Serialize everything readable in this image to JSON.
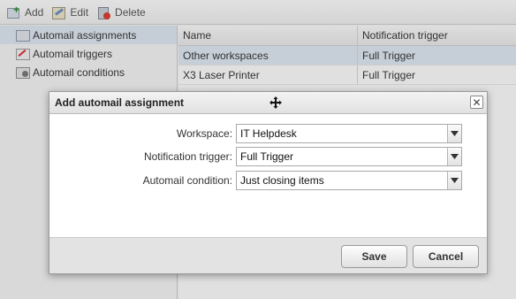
{
  "toolbar": {
    "add_label": "Add",
    "edit_label": "Edit",
    "delete_label": "Delete"
  },
  "sidebar": {
    "items": [
      {
        "label": "Automail assignments",
        "icon": "assignments-icon",
        "active": true
      },
      {
        "label": "Automail triggers",
        "icon": "triggers-icon",
        "active": false
      },
      {
        "label": "Automail conditions",
        "icon": "conditions-icon",
        "active": false
      }
    ]
  },
  "grid": {
    "columns": [
      "Name",
      "Notification trigger"
    ],
    "rows": [
      [
        "Other workspaces",
        "Full Trigger"
      ],
      [
        "X3 Laser Printer",
        "Full Trigger"
      ]
    ]
  },
  "dialog": {
    "title": "Add automail assignment",
    "fields": [
      {
        "label": "Workspace:",
        "value": "IT Helpdesk"
      },
      {
        "label": "Notification trigger:",
        "value": "Full Trigger"
      },
      {
        "label": "Automail condition:",
        "value": "Just closing items"
      }
    ],
    "save_label": "Save",
    "cancel_label": "Cancel"
  }
}
